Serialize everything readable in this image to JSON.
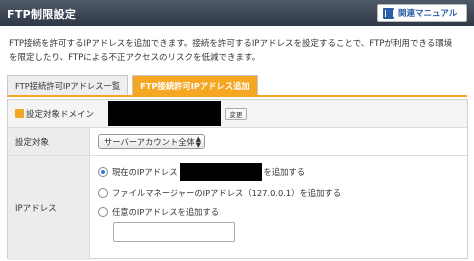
{
  "header": {
    "title": "FTP制限設定",
    "manual_label": "関連マニュアル"
  },
  "description": {
    "line1": "FTP接続を許可するIPアドレスを追加できます。接続を許可するIPアドレスを設定することで、FTPが利用できる環境",
    "line2": "を限定したり、FTPによる不正アクセスのリスクを低減できます。"
  },
  "tabs": [
    {
      "label": "FTP接続許可IPアドレス一覧",
      "active": false
    },
    {
      "label": "FTP接続許可IPアドレス追加",
      "active": true
    }
  ],
  "form": {
    "target_domain_label": "設定対象ドメイン",
    "change_label": "変更",
    "target_label": "設定対象",
    "target_select_value": "サーバーアカウント全体",
    "ip_label": "IPアドレス",
    "option_current_prefix": "現在のIPアドレス",
    "option_current_suffix": "を追加する",
    "option_filemanager": "ファイルマネージャーのIPアドレス（127.0.0.1）を追加する",
    "option_custom": "任意のIPアドレスを追加する",
    "custom_ip_value": ""
  },
  "colors": {
    "header_bg": "#3a4452",
    "accent": "#f5a623",
    "link_blue": "#2b5fa5"
  }
}
